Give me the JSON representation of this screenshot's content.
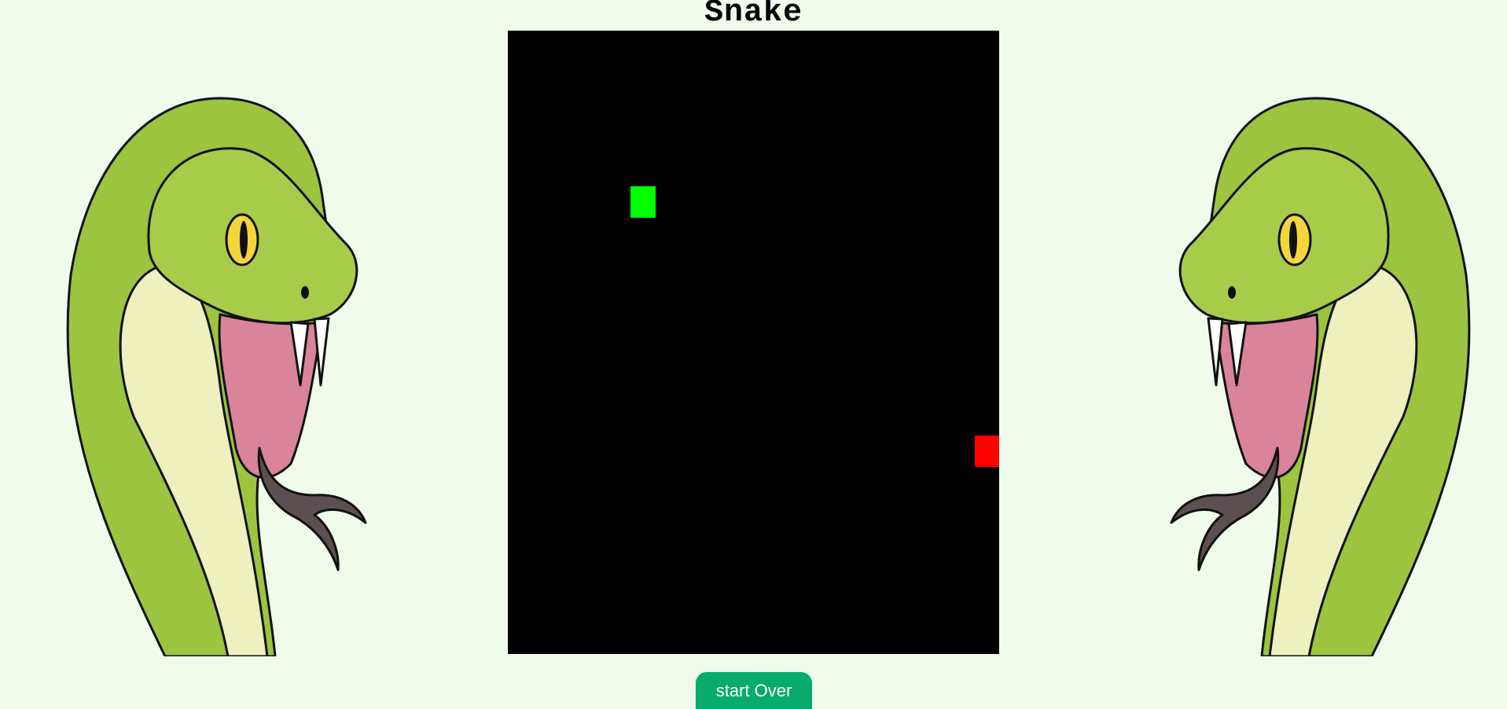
{
  "title": "Snake",
  "button": {
    "start_over_label": "start Over"
  },
  "game": {
    "columns": 20,
    "rows": 20,
    "snake": [
      {
        "col": 5,
        "row": 5
      }
    ],
    "food": {
      "col": 19,
      "row": 13
    },
    "colors": {
      "board": "#000000",
      "snake": "#00ff00",
      "food": "#ff0000"
    }
  },
  "decorations": [
    "snake-illustration-left",
    "snake-illustration-right"
  ]
}
